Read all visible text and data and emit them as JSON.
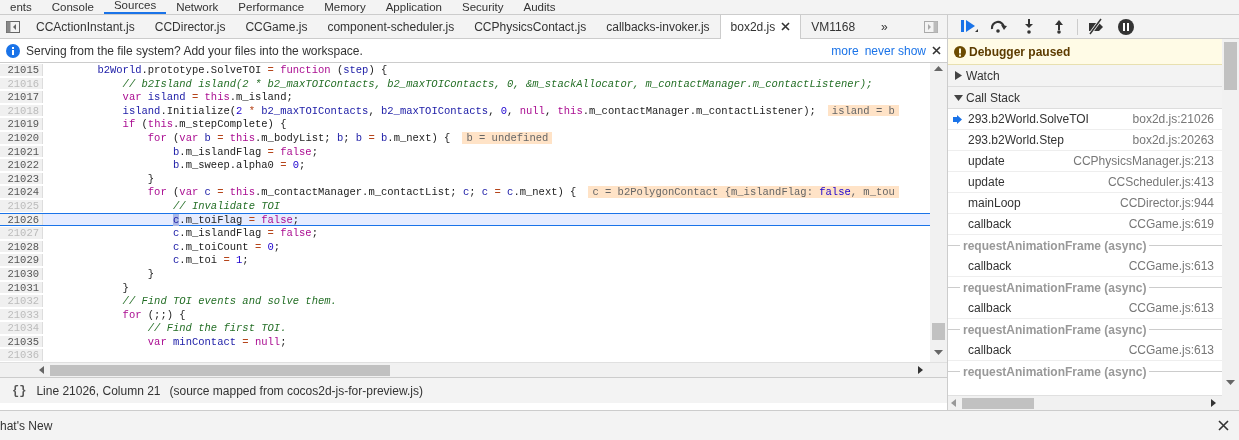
{
  "main_tabs": [
    {
      "label": "ents",
      "selected": false
    },
    {
      "label": "Console",
      "selected": false
    },
    {
      "label": "Sources",
      "selected": true
    },
    {
      "label": "Network",
      "selected": false
    },
    {
      "label": "Performance",
      "selected": false
    },
    {
      "label": "Memory",
      "selected": false
    },
    {
      "label": "Application",
      "selected": false
    },
    {
      "label": "Security",
      "selected": false
    },
    {
      "label": "Audits",
      "selected": false
    }
  ],
  "editor_tabs": [
    {
      "label": "CCActionInstant.js",
      "selected": false,
      "closable": false
    },
    {
      "label": "CCDirector.js",
      "selected": false,
      "closable": false
    },
    {
      "label": "CCGame.js",
      "selected": false,
      "closable": false
    },
    {
      "label": "component-scheduler.js",
      "selected": false,
      "closable": false
    },
    {
      "label": "CCPhysicsContact.js",
      "selected": false,
      "closable": false
    },
    {
      "label": "callbacks-invoker.js",
      "selected": false,
      "closable": false
    },
    {
      "label": "box2d.js",
      "selected": true,
      "closable": true
    },
    {
      "label": "VM1168",
      "selected": false,
      "closable": false
    }
  ],
  "tabs_overflow": "»",
  "infobar": {
    "message": "Serving from the file system? Add your files into the workspace.",
    "links": [
      "more",
      "never show"
    ]
  },
  "code": {
    "lines": [
      {
        "number": "21015",
        "breakable": true,
        "current": false,
        "tokens": [
          {
            "kind": "variable",
            "text": "        b2World"
          },
          {
            "kind": "plain",
            "text": ".prototype.SolveTOI"
          },
          {
            "kind": "operator",
            "text": " ="
          },
          {
            "kind": "keyword",
            "text": " function"
          },
          {
            "kind": "plain",
            "text": " ("
          },
          {
            "kind": "variable",
            "text": "step"
          },
          {
            "kind": "plain",
            "text": ") {"
          }
        ]
      },
      {
        "number": "21016",
        "breakable": false,
        "current": false,
        "tokens": [
          {
            "kind": "comment",
            "text": "            // b2Island island(2 * b2_maxTOIContacts, b2_maxTOIContacts, 0, &m_stackAllocator, m_contactManager.m_contactListener);"
          }
        ]
      },
      {
        "number": "21017",
        "breakable": true,
        "current": false,
        "tokens": [
          {
            "kind": "keyword",
            "text": "            var"
          },
          {
            "kind": "variable",
            "text": " island"
          },
          {
            "kind": "operator",
            "text": " ="
          },
          {
            "kind": "keyword",
            "text": " this"
          },
          {
            "kind": "plain",
            "text": ".m_island;"
          }
        ]
      },
      {
        "number": "21018",
        "breakable": false,
        "current": false,
        "tokens": [
          {
            "kind": "variable",
            "text": "            island"
          },
          {
            "kind": "plain",
            "text": ".Initialize("
          },
          {
            "kind": "number",
            "text": "2"
          },
          {
            "kind": "operator",
            "text": " *"
          },
          {
            "kind": "variable",
            "text": " b2_maxTOIContacts"
          },
          {
            "kind": "plain",
            "text": ","
          },
          {
            "kind": "variable",
            "text": " b2_maxTOIContacts"
          },
          {
            "kind": "plain",
            "text": ","
          },
          {
            "kind": "number",
            "text": " 0"
          },
          {
            "kind": "plain",
            "text": ","
          },
          {
            "kind": "keyword",
            "text": " null"
          },
          {
            "kind": "plain",
            "text": ","
          },
          {
            "kind": "keyword",
            "text": " this"
          },
          {
            "kind": "plain",
            "text": ".m_contactManager.m_contactListener);"
          }
        ],
        "inline_value": [
          {
            "kind": "plain",
            "text": "island = b"
          }
        ]
      },
      {
        "number": "21019",
        "breakable": true,
        "current": false,
        "tokens": [
          {
            "kind": "keyword",
            "text": "            if"
          },
          {
            "kind": "plain",
            "text": " ("
          },
          {
            "kind": "keyword",
            "text": "this"
          },
          {
            "kind": "plain",
            "text": ".m_stepComplete) {"
          }
        ]
      },
      {
        "number": "21020",
        "breakable": true,
        "current": false,
        "tokens": [
          {
            "kind": "keyword",
            "text": "                for"
          },
          {
            "kind": "plain",
            "text": " ("
          },
          {
            "kind": "keyword",
            "text": "var"
          },
          {
            "kind": "variable",
            "text": " b"
          },
          {
            "kind": "operator",
            "text": " ="
          },
          {
            "kind": "keyword",
            "text": " this"
          },
          {
            "kind": "plain",
            "text": ".m_bodyList;"
          },
          {
            "kind": "variable",
            "text": " b"
          },
          {
            "kind": "plain",
            "text": ";"
          },
          {
            "kind": "variable",
            "text": " b"
          },
          {
            "kind": "operator",
            "text": " ="
          },
          {
            "kind": "variable",
            "text": " b"
          },
          {
            "kind": "plain",
            "text": ".m_next) {"
          }
        ],
        "inline_value": [
          {
            "kind": "plain",
            "text": "b = undefined"
          }
        ]
      },
      {
        "number": "21021",
        "breakable": true,
        "current": false,
        "tokens": [
          {
            "kind": "variable",
            "text": "                    b"
          },
          {
            "kind": "plain",
            "text": ".m_islandFlag"
          },
          {
            "kind": "operator",
            "text": " ="
          },
          {
            "kind": "keyword",
            "text": " false"
          },
          {
            "kind": "plain",
            "text": ";"
          }
        ]
      },
      {
        "number": "21022",
        "breakable": true,
        "current": false,
        "tokens": [
          {
            "kind": "variable",
            "text": "                    b"
          },
          {
            "kind": "plain",
            "text": ".m_sweep.alpha0"
          },
          {
            "kind": "operator",
            "text": " ="
          },
          {
            "kind": "number",
            "text": " 0"
          },
          {
            "kind": "plain",
            "text": ";"
          }
        ]
      },
      {
        "number": "21023",
        "breakable": true,
        "current": false,
        "tokens": [
          {
            "kind": "plain",
            "text": "                }"
          }
        ]
      },
      {
        "number": "21024",
        "breakable": true,
        "current": false,
        "tokens": [
          {
            "kind": "keyword",
            "text": "                for"
          },
          {
            "kind": "plain",
            "text": " ("
          },
          {
            "kind": "keyword",
            "text": "var"
          },
          {
            "kind": "variable",
            "text": " c"
          },
          {
            "kind": "operator",
            "text": " ="
          },
          {
            "kind": "keyword",
            "text": " this"
          },
          {
            "kind": "plain",
            "text": ".m_contactManager.m_contactList;"
          },
          {
            "kind": "variable",
            "text": " c"
          },
          {
            "kind": "plain",
            "text": ";"
          },
          {
            "kind": "variable",
            "text": " c"
          },
          {
            "kind": "operator",
            "text": " ="
          },
          {
            "kind": "variable",
            "text": " c"
          },
          {
            "kind": "plain",
            "text": ".m_next) {"
          }
        ],
        "inline_value": [
          {
            "kind": "plain",
            "text": "c = b2PolygonContact {m_islandFlag: "
          },
          {
            "kind": "number",
            "text": "false"
          },
          {
            "kind": "plain",
            "text": ", m_tou"
          }
        ]
      },
      {
        "number": "21025",
        "breakable": false,
        "current": false,
        "tokens": [
          {
            "kind": "comment",
            "text": "                    // Invalidate TOI"
          }
        ]
      },
      {
        "number": "21026",
        "breakable": true,
        "current": true,
        "tokens": [
          {
            "kind": "paused",
            "text": "                    c"
          },
          {
            "kind": "plain",
            "text": ".m_toiFlag"
          },
          {
            "kind": "operator",
            "text": " ="
          },
          {
            "kind": "keyword",
            "text": " false"
          },
          {
            "kind": "plain",
            "text": ";"
          }
        ]
      },
      {
        "number": "21027",
        "breakable": false,
        "current": false,
        "tokens": [
          {
            "kind": "variable",
            "text": "                    c"
          },
          {
            "kind": "plain",
            "text": ".m_islandFlag"
          },
          {
            "kind": "operator",
            "text": " ="
          },
          {
            "kind": "keyword",
            "text": " false"
          },
          {
            "kind": "plain",
            "text": ";"
          }
        ]
      },
      {
        "number": "21028",
        "breakable": true,
        "current": false,
        "tokens": [
          {
            "kind": "variable",
            "text": "                    c"
          },
          {
            "kind": "plain",
            "text": ".m_toiCount"
          },
          {
            "kind": "operator",
            "text": " ="
          },
          {
            "kind": "number",
            "text": " 0"
          },
          {
            "kind": "plain",
            "text": ";"
          }
        ]
      },
      {
        "number": "21029",
        "breakable": true,
        "current": false,
        "tokens": [
          {
            "kind": "variable",
            "text": "                    c"
          },
          {
            "kind": "plain",
            "text": ".m_toi"
          },
          {
            "kind": "operator",
            "text": " ="
          },
          {
            "kind": "number",
            "text": " 1"
          },
          {
            "kind": "plain",
            "text": ";"
          }
        ]
      },
      {
        "number": "21030",
        "breakable": true,
        "current": false,
        "tokens": [
          {
            "kind": "plain",
            "text": "                }"
          }
        ]
      },
      {
        "number": "21031",
        "breakable": true,
        "current": false,
        "tokens": [
          {
            "kind": "plain",
            "text": "            }"
          }
        ]
      },
      {
        "number": "21032",
        "breakable": false,
        "current": false,
        "tokens": [
          {
            "kind": "comment",
            "text": "            // Find TOI events and solve them."
          }
        ]
      },
      {
        "number": "21033",
        "breakable": false,
        "current": false,
        "tokens": [
          {
            "kind": "keyword",
            "text": "            for"
          },
          {
            "kind": "plain",
            "text": " (;;) {"
          }
        ]
      },
      {
        "number": "21034",
        "breakable": false,
        "current": false,
        "tokens": [
          {
            "kind": "comment",
            "text": "                // Find the first TOI."
          }
        ]
      },
      {
        "number": "21035",
        "breakable": true,
        "current": false,
        "tokens": [
          {
            "kind": "keyword",
            "text": "                var"
          },
          {
            "kind": "variable",
            "text": " minContact"
          },
          {
            "kind": "operator",
            "text": " ="
          },
          {
            "kind": "keyword",
            "text": " null"
          },
          {
            "kind": "plain",
            "text": ";"
          }
        ]
      },
      {
        "number": "21036",
        "breakable": false,
        "current": false
      }
    ]
  },
  "status_bar": {
    "format_button": "{}",
    "position": "Line 21026, Column 21",
    "source_map": "(source mapped from cocos2d-js-for-preview.js)"
  },
  "debugger": {
    "banner": "Debugger paused",
    "sections": [
      {
        "title": "Watch",
        "expanded": false
      },
      {
        "title": "Call Stack",
        "expanded": true
      }
    ],
    "call_stack": [
      {
        "kind": "frame",
        "name": "293.b2World.SolveTOI",
        "location": "box2d.js:21026",
        "selected": true
      },
      {
        "kind": "frame",
        "name": "293.b2World.Step",
        "location": "box2d.js:20263",
        "selected": false
      },
      {
        "kind": "frame",
        "name": "update",
        "location": "CCPhysicsManager.js:213",
        "selected": false
      },
      {
        "kind": "frame",
        "name": "update",
        "location": "CCScheduler.js:413",
        "selected": false
      },
      {
        "kind": "frame",
        "name": "mainLoop",
        "location": "CCDirector.js:944",
        "selected": false
      },
      {
        "kind": "frame",
        "name": "callback",
        "location": "CCGame.js:619",
        "selected": false
      },
      {
        "kind": "async",
        "label": "requestAnimationFrame (async)"
      },
      {
        "kind": "frame",
        "name": "callback",
        "location": "CCGame.js:613",
        "selected": false
      },
      {
        "kind": "async",
        "label": "requestAnimationFrame (async)"
      },
      {
        "kind": "frame",
        "name": "callback",
        "location": "CCGame.js:613",
        "selected": false
      },
      {
        "kind": "async",
        "label": "requestAnimationFrame (async)"
      },
      {
        "kind": "frame",
        "name": "callback",
        "location": "CCGame.js:613",
        "selected": false
      },
      {
        "kind": "async",
        "label": "requestAnimationFrame (async)"
      }
    ]
  },
  "drawer": {
    "tab": "hat's New"
  }
}
